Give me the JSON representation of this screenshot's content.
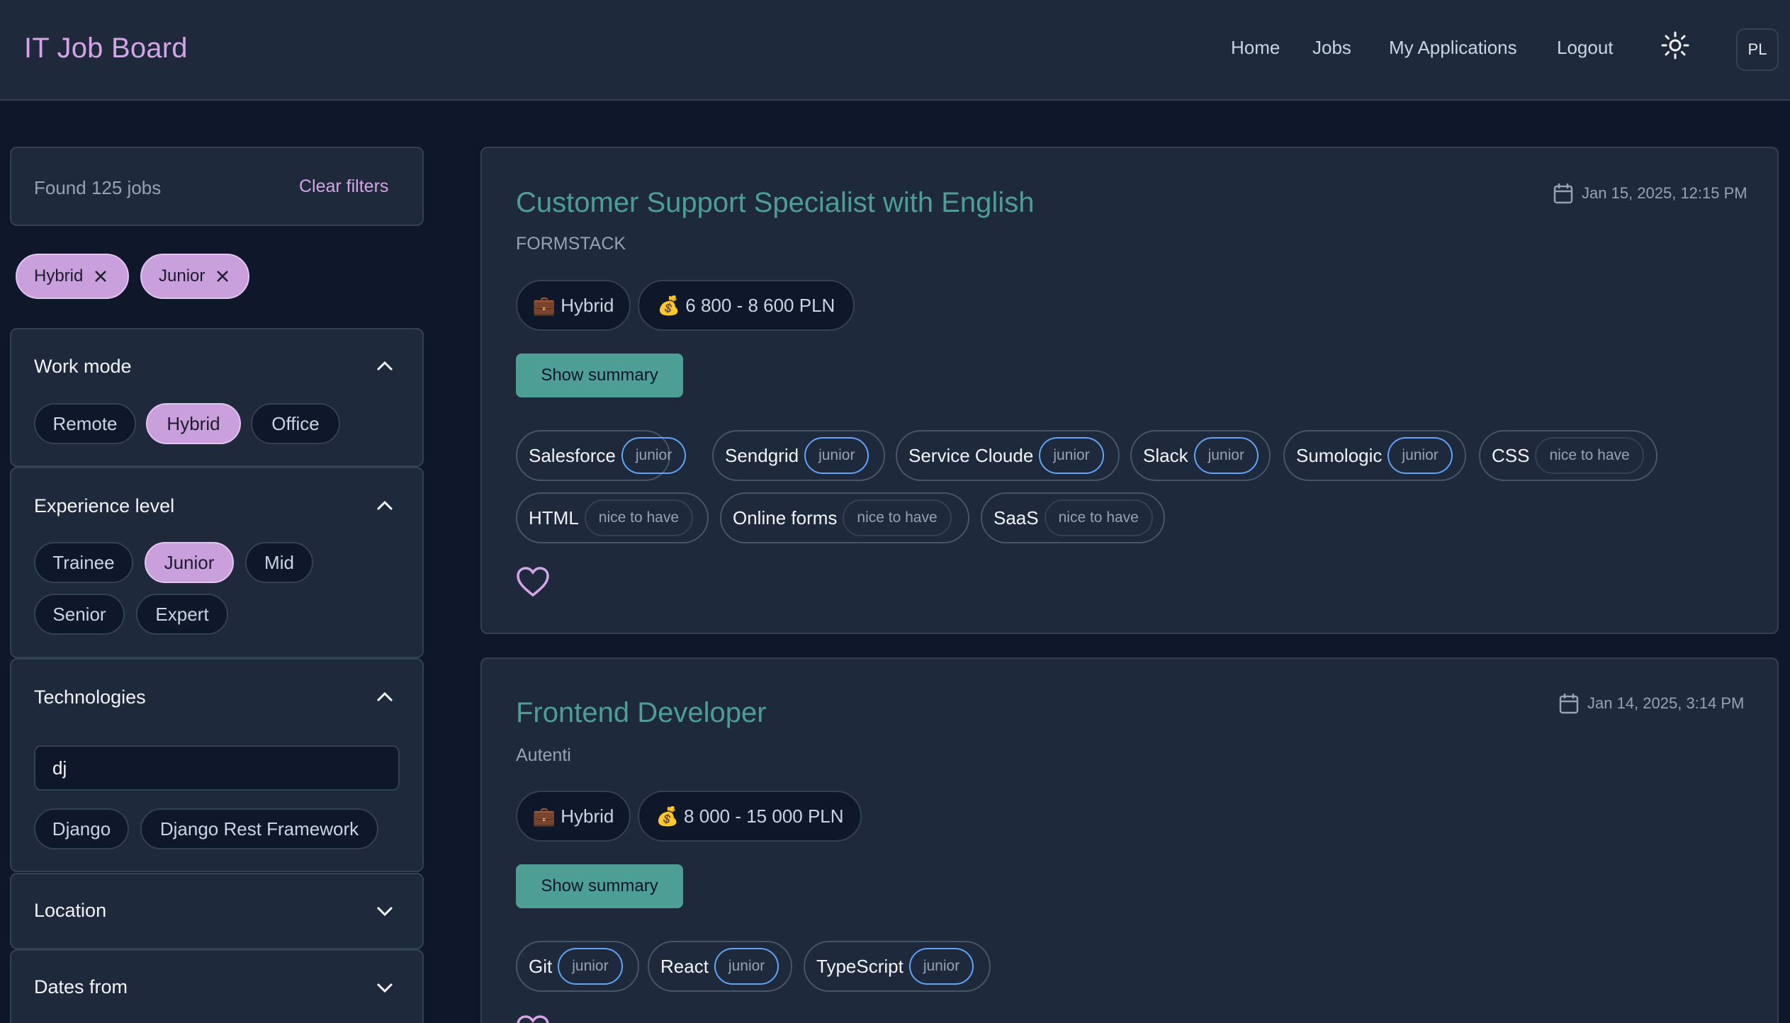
{
  "header": {
    "logo": "IT Job Board",
    "nav": [
      "Home",
      "Jobs",
      "My Applications",
      "Logout"
    ],
    "lang": "PL"
  },
  "sidebar": {
    "found": "Found 125 jobs",
    "clear": "Clear filters",
    "active_filters": [
      "Hybrid",
      "Junior"
    ],
    "work_mode": {
      "title": "Work mode",
      "options": [
        "Remote",
        "Hybrid",
        "Office"
      ],
      "selected": "Hybrid"
    },
    "experience": {
      "title": "Experience level",
      "options": [
        "Trainee",
        "Junior",
        "Mid",
        "Senior",
        "Expert"
      ],
      "selected": "Junior"
    },
    "technologies": {
      "title": "Technologies",
      "input_value": "dj",
      "suggestions": [
        "Django",
        "Django Rest Framework"
      ]
    },
    "location": {
      "title": "Location"
    },
    "dates": {
      "title": "Dates from"
    }
  },
  "jobs": [
    {
      "title": "Customer Support Specialist with English",
      "company": "FORMSTACK",
      "date": "Jan 15, 2025, 12:15 PM",
      "mode": "💼 Hybrid",
      "salary": "💰 6 800 - 8 600 PLN",
      "summary_label": "Show summary",
      "skills": [
        {
          "name": "Salesforce",
          "level": "junior"
        },
        {
          "name": "Sendgrid",
          "level": "junior"
        },
        {
          "name": "Service Cloude",
          "level": "junior"
        },
        {
          "name": "Slack",
          "level": "junior"
        },
        {
          "name": "Sumologic",
          "level": "junior"
        },
        {
          "name": "CSS",
          "level": "nice to have"
        },
        {
          "name": "HTML",
          "level": "nice to have"
        },
        {
          "name": "Online forms",
          "level": "nice to have"
        },
        {
          "name": "SaaS",
          "level": "nice to have"
        }
      ]
    },
    {
      "title": "Frontend Developer",
      "company": "Autenti",
      "date": "Jan 14, 2025, 3:14 PM",
      "mode": "💼 Hybrid",
      "salary": "💰 8 000 - 15 000 PLN",
      "summary_label": "Show summary",
      "skills": [
        {
          "name": "Git",
          "level": "junior"
        },
        {
          "name": "React",
          "level": "junior"
        },
        {
          "name": "TypeScript",
          "level": "junior"
        }
      ]
    }
  ],
  "colors": {
    "accent": "#d4a5e6",
    "teal": "#4d9e94",
    "bg": "#0f172a",
    "panel": "#1e293b"
  }
}
